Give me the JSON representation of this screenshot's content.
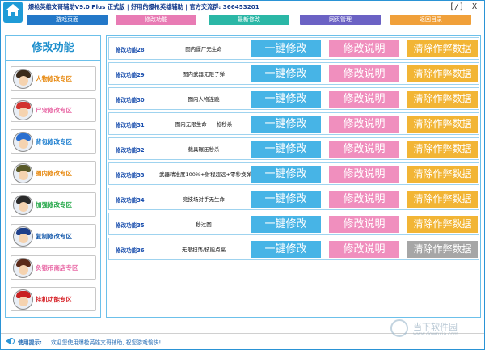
{
  "window": {
    "title": "爆枪英雄文哥辅助V9.0 Plus 正式版 | 好用的爆枪英雄辅助 | 官方交流群: 366453201",
    "minimize_glyph": "_",
    "restore_glyph": "[/]",
    "close_glyph": "X"
  },
  "topnav": {
    "tabs": [
      {
        "label": "游戏页面",
        "color": "#2378c8"
      },
      {
        "label": "修改功能",
        "color": "#e87bb4"
      },
      {
        "label": "最新修改",
        "color": "#2bb7a6"
      },
      {
        "label": "网页管理",
        "color": "#6b62c4"
      },
      {
        "label": "返回目录",
        "color": "#f0a03a"
      }
    ]
  },
  "sidebar": {
    "title": "修改功能",
    "items": [
      {
        "label": "人物修改专区",
        "color": "#e78a12",
        "icon": "character-avatar-icon"
      },
      {
        "label": "尸宠修改专区",
        "color": "#e86aa6",
        "icon": "pet-avatar-icon"
      },
      {
        "label": "背包修改专区",
        "color": "#1d7ecf",
        "icon": "backpack-avatar-icon"
      },
      {
        "label": "图内修改专区",
        "color": "#e78a12",
        "icon": "map-avatar-icon"
      },
      {
        "label": "加强修改专区",
        "color": "#26a84a",
        "icon": "boost-avatar-icon"
      },
      {
        "label": "复制修改专区",
        "color": "#1d5fae",
        "icon": "copy-avatar-icon"
      },
      {
        "label": "负银币商店专区",
        "color": "#e86aa6",
        "icon": "shop-avatar-icon"
      },
      {
        "label": "挂机功能专区",
        "color": "#d7262b",
        "icon": "afk-avatar-icon"
      }
    ]
  },
  "features": {
    "apply_label": "一键修改",
    "explain_label": "修改说明",
    "clear_label": "清除作弊数据",
    "rows": [
      {
        "name": "修改功能28",
        "desc": "图内僵尸无生命",
        "clear_enabled": true
      },
      {
        "name": "修改功能29",
        "desc": "图内武器无限子弹",
        "clear_enabled": true
      },
      {
        "name": "修改功能30",
        "desc": "图内人物连跳",
        "clear_enabled": true
      },
      {
        "name": "修改功能31",
        "desc": "图内无限生命+一枪秒杀",
        "clear_enabled": true
      },
      {
        "name": "修改功能32",
        "desc": "载具碾压秒杀",
        "clear_enabled": true
      },
      {
        "name": "修改功能33",
        "desc": "武器精准度100%+射程超远+零秒换弹",
        "clear_enabled": true
      },
      {
        "name": "修改功能34",
        "desc": "竞技场对手无生命",
        "clear_enabled": true
      },
      {
        "name": "修改功能35",
        "desc": "秒过图",
        "clear_enabled": true
      },
      {
        "name": "修改功能36",
        "desc": "无限扫荡/技能点高",
        "clear_enabled": false
      }
    ]
  },
  "status": {
    "label": "使用提示:",
    "text": "欢迎您使用爆枪英雄文哥辅助, 祝您游戏愉快!"
  },
  "watermark": {
    "text": "当下软件园",
    "sub": "www.downxia.com"
  }
}
